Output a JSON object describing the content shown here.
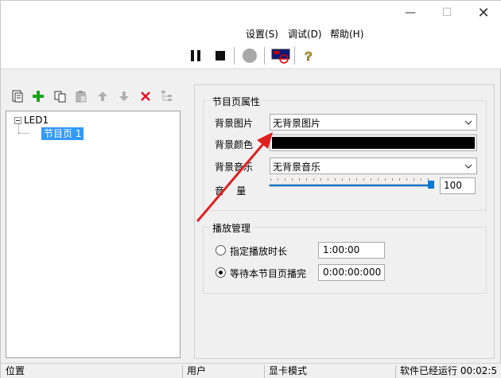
{
  "window": {
    "controls": {
      "minimize": "—",
      "maximize": "☐",
      "close": "✕"
    }
  },
  "menu": {
    "settings": "设置(S)",
    "debug": "调试(D)",
    "help": "帮助(H)"
  },
  "toolbar": {
    "icons": [
      "pause-icon",
      "stop-icon",
      "record-icon",
      "screen-off-icon",
      "help-icon"
    ]
  },
  "left_panel": {
    "toolbar_icons": [
      "new-page-icon",
      "add-icon",
      "copy-icon",
      "paste-icon",
      "move-up-icon",
      "move-down-icon",
      "delete-icon",
      "tree-structure-icon"
    ],
    "tree": {
      "root": "LED1",
      "children": [
        "节目页 1"
      ]
    }
  },
  "page_properties": {
    "title": "节目页属性",
    "bg_image_label": "背景图片",
    "bg_image_value": "无背景图片",
    "bg_color_label": "背景颜色",
    "bg_color_value": "#000000",
    "bg_music_label": "背景音乐",
    "bg_music_value": "无背景音乐",
    "volume_label": "音    量",
    "volume_value": "100",
    "volume_level": 1.0
  },
  "playback": {
    "title": "播放管理",
    "option_duration_label": "指定播放时长",
    "option_duration_value": "1:00:00",
    "option_wait_label": "等待本节目页播完",
    "option_wait_value": "0:00:00:000",
    "selected": "wait"
  },
  "status_bar": {
    "position": "位置",
    "user": "用户",
    "display_mode": "显卡模式",
    "runtime": "软件已经运行 00:02:5"
  },
  "colors": {
    "accent": "#0078d7",
    "selection": "#3399ff",
    "delete": "#e81123",
    "add": "#1aa31a",
    "annotation_arrow": "#e02020"
  }
}
